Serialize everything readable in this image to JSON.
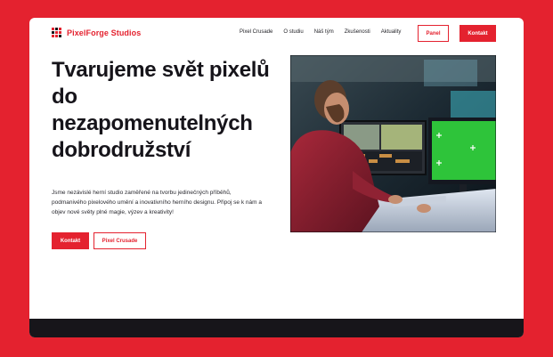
{
  "brand": {
    "name": "PixelForge Studios",
    "accent_color": "#e4222f",
    "dark_color": "#17151a"
  },
  "nav": {
    "items": [
      "Pixel Crusade",
      "O studiu",
      "Náš tým",
      "Zkušenosti",
      "Aktuality"
    ],
    "panel_label": "Panel",
    "contact_label": "Kontakt"
  },
  "hero": {
    "title": "Tvarujeme svět pixelů do nezapomenutelných dobrodružství",
    "text": "Jsme nezávislé herní studio zaměřené na tvorbu jedinečných příběhů, podmanivého pixelového umění a inovativního herního designu. Připoj se k nám a objev nové světy plné magie, výzev a kreativity!",
    "primary_button": "Kontakt",
    "secondary_button": "Pixel Crusade",
    "image_icon": "developer-at-workstation-photo"
  }
}
